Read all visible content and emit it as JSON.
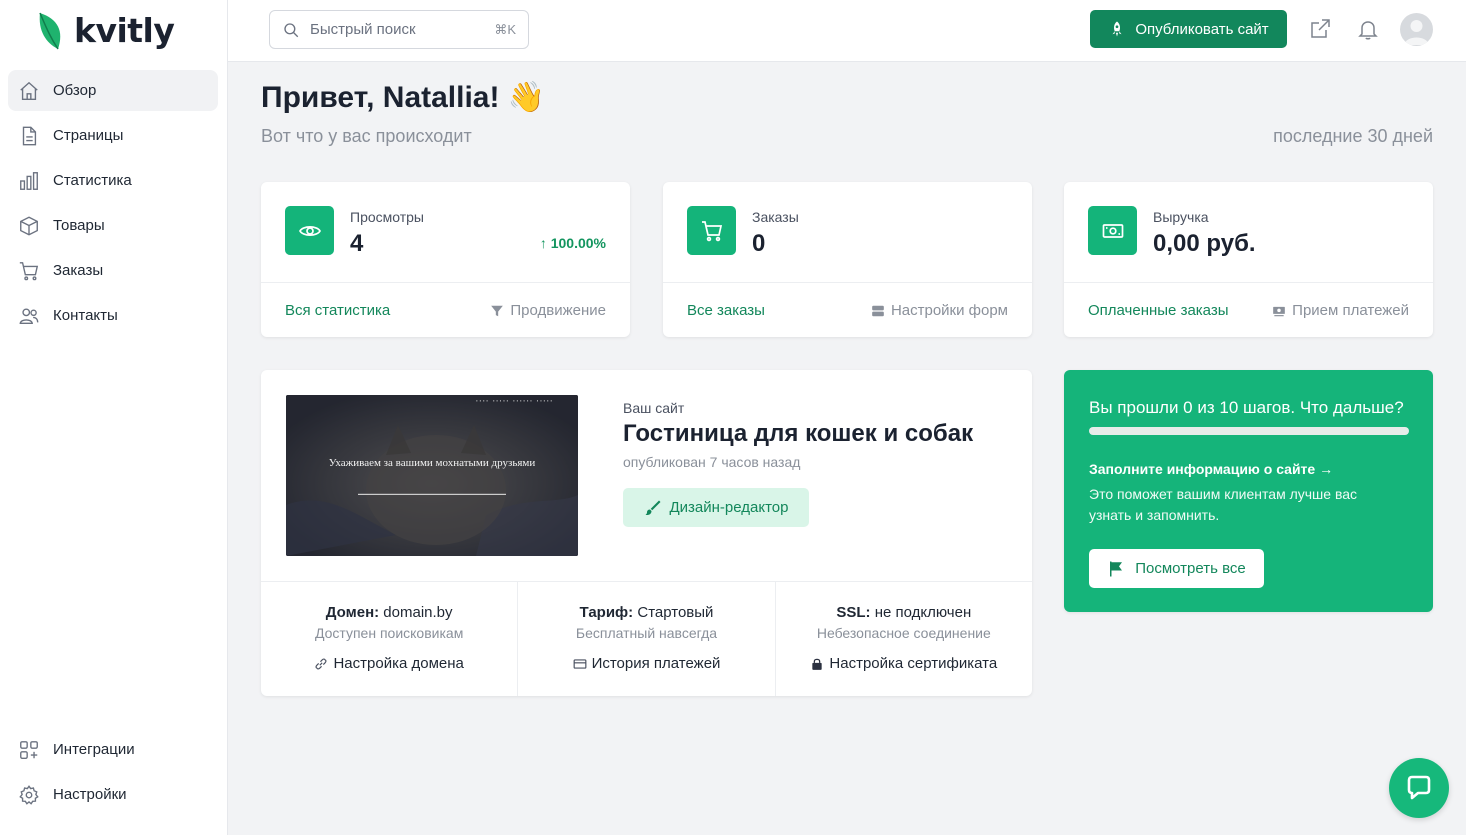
{
  "brand": {
    "name": "kvitly",
    "accent": "#14b47a"
  },
  "sidebar": {
    "items": [
      {
        "label": "Обзор",
        "icon": "home-icon",
        "active": true
      },
      {
        "label": "Страницы",
        "icon": "document-icon"
      },
      {
        "label": "Статистика",
        "icon": "bar-chart-icon"
      },
      {
        "label": "Товары",
        "icon": "cube-icon"
      },
      {
        "label": "Заказы",
        "icon": "cart-icon"
      },
      {
        "label": "Контакты",
        "icon": "users-icon"
      }
    ],
    "bottom_items": [
      {
        "label": "Интеграции",
        "icon": "grid-plus-icon"
      },
      {
        "label": "Настройки",
        "icon": "gear-icon"
      }
    ]
  },
  "header": {
    "search": {
      "placeholder": "Быстрый поиск",
      "shortcut": "⌘K"
    },
    "publish_label": "Опубликовать сайт"
  },
  "main": {
    "greeting": "Привет, Natallia! 👋",
    "subtitle": "Вот что у вас происходит",
    "period": "последние 30 дней"
  },
  "stats": [
    {
      "label": "Просмотры",
      "value": "4",
      "delta": "↑ 100.00%",
      "link": "Вся статистика",
      "secondary_link": "Продвижение",
      "icon": "eye-icon"
    },
    {
      "label": "Заказы",
      "value": "0",
      "delta": "",
      "link": "Все заказы",
      "secondary_link": "Настройки форм",
      "icon": "cart-icon"
    },
    {
      "label": "Выручка",
      "value": "0,00 руб.",
      "delta": "",
      "link": "Оплаченные заказы",
      "secondary_link": "Прием платежей",
      "icon": "money-icon"
    }
  ],
  "site": {
    "label": "Ваш сайт",
    "name": "Гостиница для кошек и собак",
    "published": "опубликован 7 часов назад",
    "design_button": "Дизайн-редактор",
    "thumbnail": {
      "title": "Ухаживаем за вашими мохнатыми друзьями"
    },
    "domain": {
      "key": "Домен:",
      "value": "domain.by",
      "note": "Доступен поисковикам",
      "link": "Настройка домена"
    },
    "plan": {
      "key": "Тариф:",
      "value": "Стартовый",
      "note": "Бесплатный навсегда",
      "link": "История платежей"
    },
    "ssl": {
      "key": "SSL:",
      "value": "не подключен",
      "note": "Небезопасное соединение",
      "link": "Настройка сертификата"
    }
  },
  "onboarding": {
    "title": "Вы прошли 0 из 10 шагов. Что дальше?",
    "progress": 0,
    "link": "Заполните информацию о сайте →",
    "text": "Это поможет вашим клиентам лучше вас узнать и запомнить.",
    "button": "Посмотреть все"
  }
}
